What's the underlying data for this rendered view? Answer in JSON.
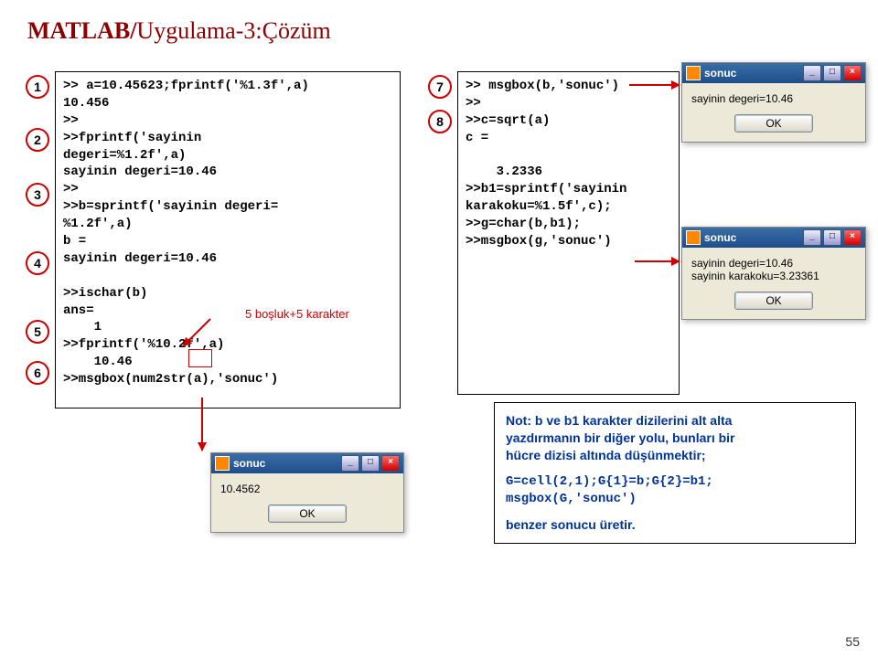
{
  "title": {
    "bold": "MATLAB/",
    "rest": "Uygulama-3:Çözüm"
  },
  "bullets": {
    "b1": "1",
    "b2": "2",
    "b3": "3",
    "b4": "4",
    "b5": "5",
    "b6": "6",
    "b7": "7",
    "b8": "8"
  },
  "code_left": ">> a=10.45623;fprintf('%1.3f',a)\n10.456\n>>\n>>fprintf('sayinin\ndegeri=%1.2f',a)\nsayinin degeri=10.46\n>>\n>>b=sprintf('sayinin degeri=\n%1.2f',a)\nb =\nsayinin degeri=10.46\n\n>>ischar(b)\nans=\n    1\n>>fprintf('%10.2f',a)\n    10.46\n>>msgbox(num2str(a),'sonuc')",
  "code_right": ">> msgbox(b,'sonuc')\n>>\n>>c=sqrt(a)\nc =\n\n    3.2336\n>>b1=sprintf('sayinin\nkarakoku=%1.5f',c);\n>>g=char(b,b1);\n>>msgbox(g,'sonuc')",
  "redlabel": "5 boşluk+5 karakter",
  "note": {
    "l1": "Not: b ve b1 karakter dizilerini alt alta",
    "l2": "yazdırmanın bir diğer yolu, bunları bir",
    "l3": "hücre dizisi altında düşünmektir;",
    "l4": "G=cell(2,1);G{1}=b;G{2}=b1;",
    "l5": "msgbox(G,'sonuc')",
    "l6": "benzer sonucu üretir."
  },
  "dlg": {
    "title": "sonuc",
    "ok": "OK",
    "d1_body": "10.4562",
    "d2_body": "sayinin degeri=10.46",
    "d3_body1": "sayinin degeri=10.46",
    "d3_body2": "sayinin karakoku=3.23361"
  },
  "pagenum": "55"
}
